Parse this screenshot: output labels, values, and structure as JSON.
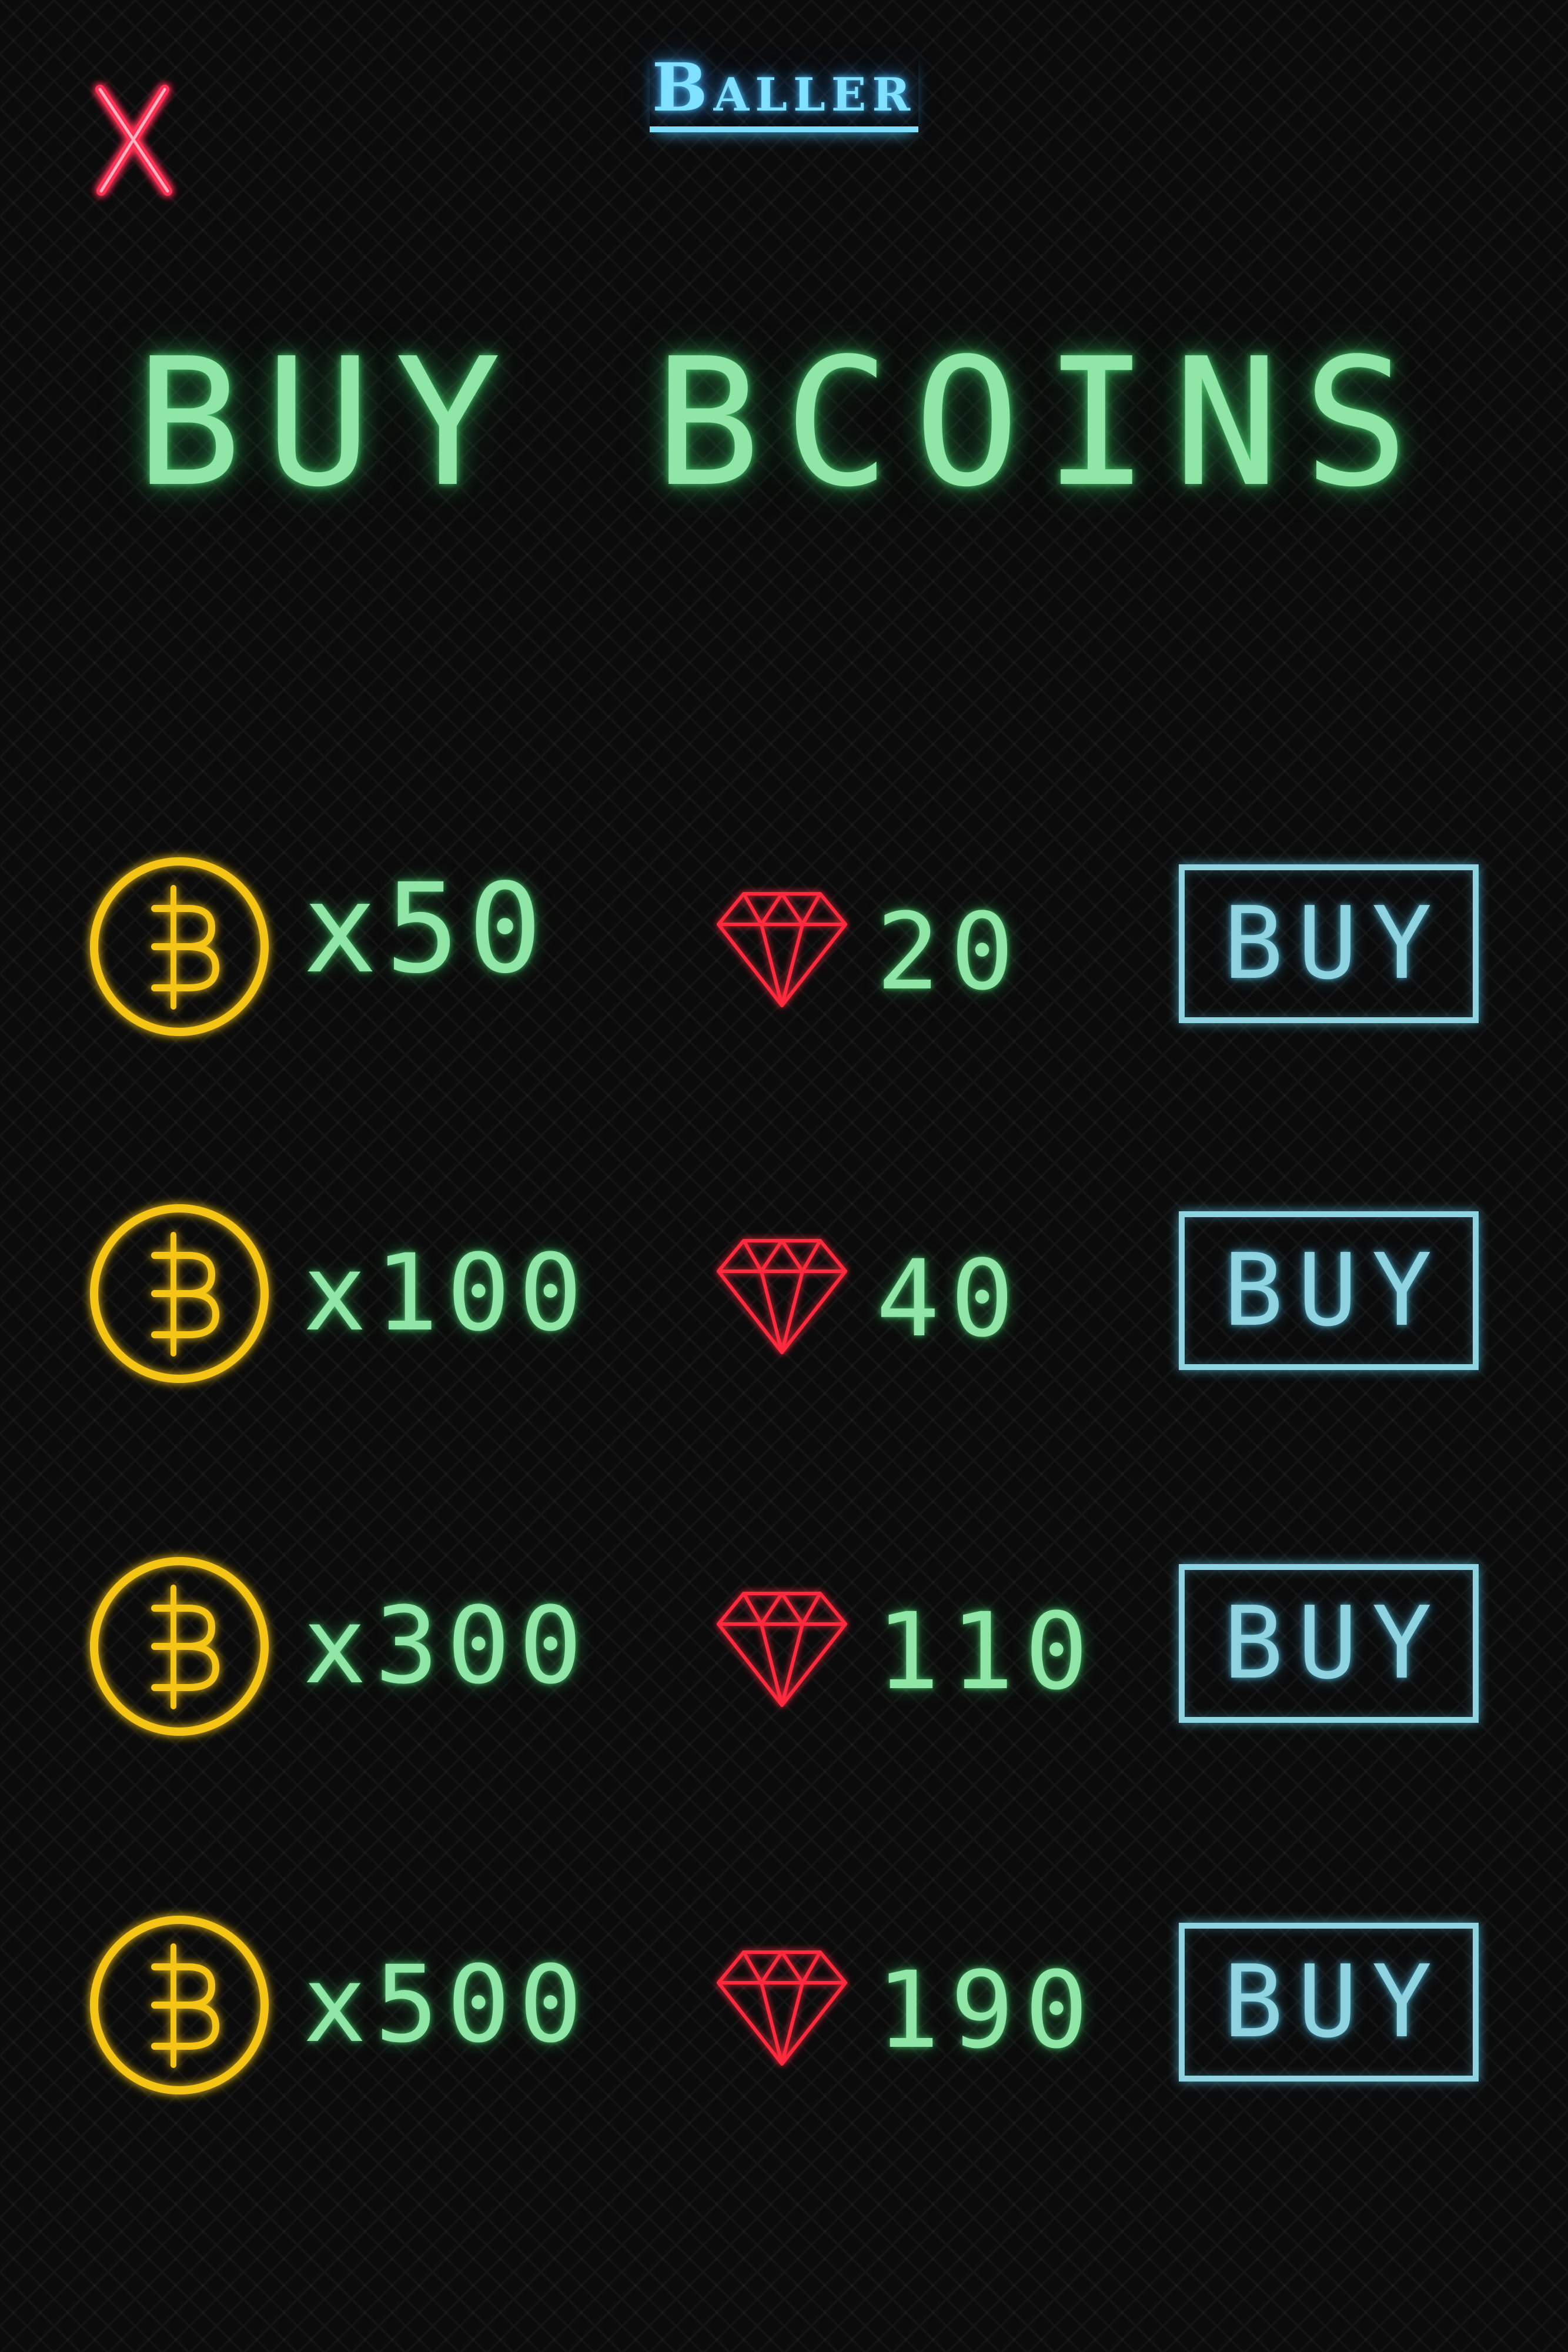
{
  "app": {
    "brand": "Baller"
  },
  "close": {
    "label": "X"
  },
  "title": "BUY BCOINS",
  "colors": {
    "background": "#0b0b0b",
    "close_red": "#ff3355",
    "brand_blue": "#7fe0ff",
    "text_green": "#8fe6a6",
    "coin_gold": "#f5c518",
    "gem_red": "#ff2a3d",
    "button_cyan": "#8fd3e0"
  },
  "icons": {
    "close": "close-icon",
    "coin": "bitcoin-coin-icon",
    "gem": "ruby-gem-icon"
  },
  "offers": [
    {
      "amount": "x50",
      "price": "20",
      "button": "BUY"
    },
    {
      "amount": "x100",
      "price": "40",
      "button": "BUY"
    },
    {
      "amount": "x300",
      "price": "110",
      "button": "BUY"
    },
    {
      "amount": "x500",
      "price": "190",
      "button": "BUY"
    }
  ]
}
